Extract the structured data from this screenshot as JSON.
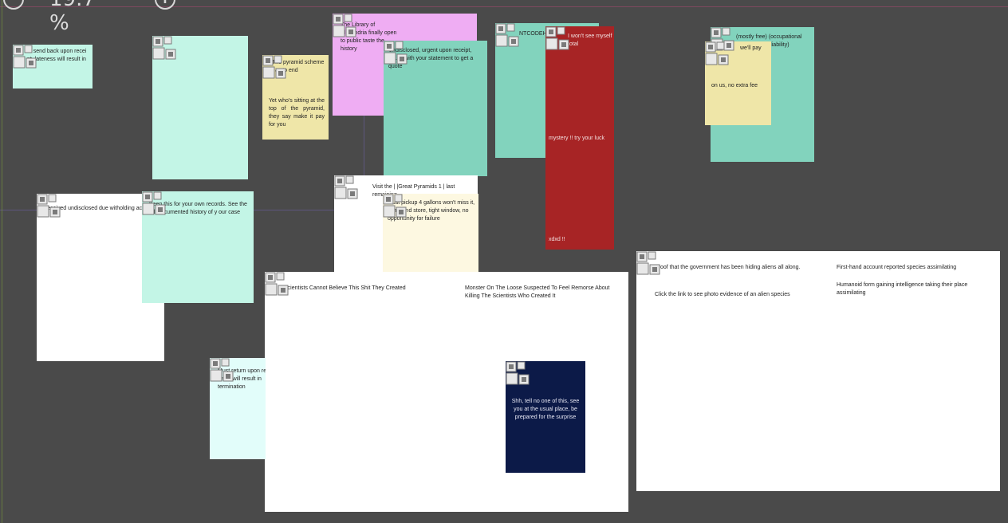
{
  "toolbar": {
    "zoom_label": "19.7 %",
    "zoom_out_symbol": "−",
    "zoom_in_symbol": "+"
  },
  "colors": {
    "canvas": "#4a4a4a",
    "mint": "#c3f5e6",
    "teal": "#82d3bd",
    "pink": "#efadf3",
    "khaki": "#efe6a8",
    "cream": "#fdf8e1",
    "red": "#a72425",
    "navy": "#0c1a48",
    "light_cyan": "#e2fdfa",
    "white": "#ffffff"
  },
  "icons": {
    "corner_marker": "qr-code-icon"
  },
  "notes": {
    "send_back": "to send back upon recei pt, lateness will result in",
    "pyramid_scheme_title": "The pyramid scheme has to end",
    "pyramid_scheme_body": "Yet who's sitting at the top of the pyramid, they say make it pay for you",
    "library": "The Library of Alexandria finally open to public taste the history",
    "undisclosed": "Undisclosed, urgent upon receipt, return with your statement to get a quote",
    "teal_top": "NTCODEHUB",
    "red_top": "I won't see myself total",
    "red_mid": "mystery !! try your luck",
    "red_bottom": "xdxd !!",
    "occupational": "(mostly free) (occupational hazard) (take liability)",
    "well_pay": "we'll pay",
    "on_us": "on us, no extra fee",
    "withholding": "Received undisclosed due witholding actions",
    "records": "Keep this for your own records. See the full documented history of y our case",
    "pyramids_visit": "Visit the | |Great Pyramids 1 | last remaining",
    "pickup": "Must pickup 4 gallons won't miss it, in my 2nd store, tight window, no opportunity for failure",
    "scientists": "Scientists Cannot Believe This Shit They Created",
    "monster": "Monster On The Loose Suspected To Feel Remorse About Killing The Scientists Who Created It",
    "shh": "Shh, tell no one of this, see you at the usual place, be prepared for the surprise",
    "return_termination": "Must return upon receipt, delay will result in termination",
    "aliens_proof": "Proof that the government has been hiding aliens all along.",
    "aliens_link": "Click the link to see photo evidence of an alien species",
    "firsthand": "First-hand account reported species assimilating",
    "humanoid": "Humanoid form gaining intelligence taking their place assimilating"
  }
}
